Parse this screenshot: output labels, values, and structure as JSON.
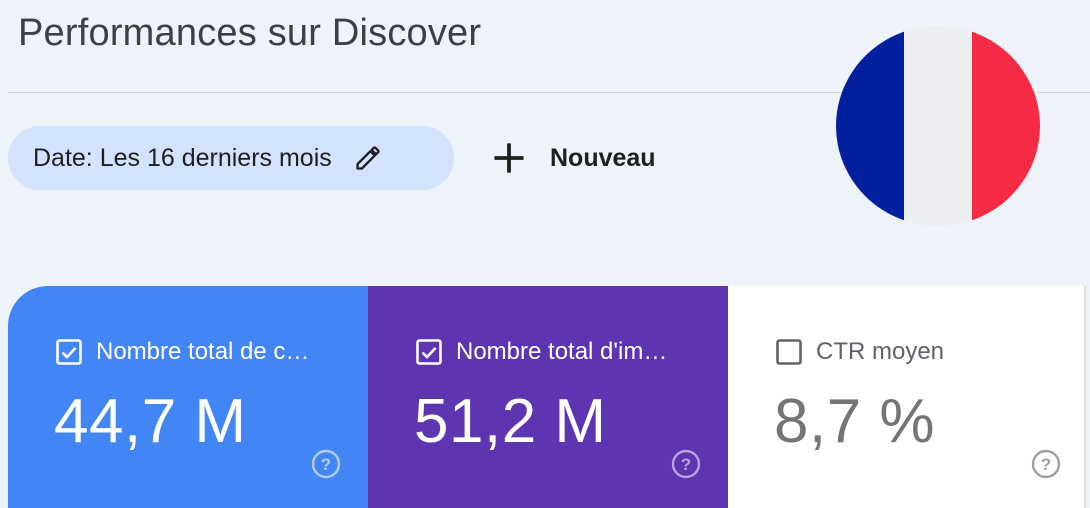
{
  "header": {
    "title": "Performances sur Discover"
  },
  "toolbar": {
    "date_filter_label": "Date: Les 16 derniers mois",
    "new_label": "Nouveau"
  },
  "flag": {
    "colors": [
      "#0020a0",
      "#eceef2",
      "#f52a44"
    ]
  },
  "metrics": [
    {
      "label": "Nombre total de c…",
      "value": "44,7 M",
      "checked": true,
      "color": "#4285f4"
    },
    {
      "label": "Nombre total d'im…",
      "value": "51,2 M",
      "checked": true,
      "color": "#5e35b1"
    },
    {
      "label": "CTR moyen",
      "value": "8,7 %",
      "checked": false,
      "color": "#ffffff"
    }
  ],
  "icons": {
    "edit": "pencil-icon",
    "add": "plus-icon",
    "help": "help-circle-icon",
    "checkbox_on": "checkbox-checked-icon",
    "checkbox_off": "checkbox-unchecked-icon"
  }
}
